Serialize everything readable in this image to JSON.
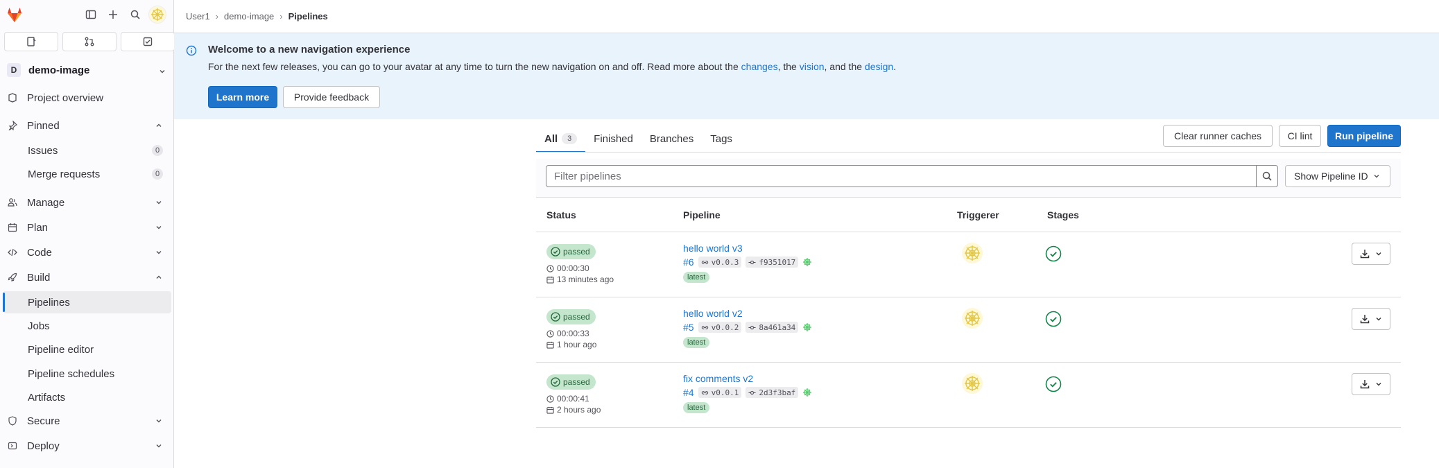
{
  "breadcrumb": {
    "items": [
      "User1",
      "demo-image"
    ],
    "current": "Pipelines"
  },
  "sidebar": {
    "project_initial": "D",
    "project_name": "demo-image",
    "overview": "Project overview",
    "pinned": "Pinned",
    "pinned_items": [
      {
        "label": "Issues",
        "count": "0"
      },
      {
        "label": "Merge requests",
        "count": "0"
      }
    ],
    "manage": "Manage",
    "plan": "Plan",
    "code": "Code",
    "build": "Build",
    "build_items": [
      "Pipelines",
      "Jobs",
      "Pipeline editor",
      "Pipeline schedules",
      "Artifacts"
    ],
    "secure": "Secure",
    "deploy": "Deploy"
  },
  "banner": {
    "title": "Welcome to a new navigation experience",
    "text_1": "For the next few releases, you can go to your avatar at any time to turn the new navigation on and off. Read more about the ",
    "link_1": "changes",
    "text_2": ", the ",
    "link_2": "vision",
    "text_3": ", and the ",
    "link_3": "design",
    "text_4": ".",
    "learn_more": "Learn more",
    "feedback": "Provide feedback"
  },
  "tabs": [
    {
      "label": "All",
      "count": "3"
    },
    {
      "label": "Finished"
    },
    {
      "label": "Branches"
    },
    {
      "label": "Tags"
    }
  ],
  "actions": {
    "clear_cache": "Clear runner caches",
    "ci_lint": "CI lint",
    "run": "Run pipeline"
  },
  "filter": {
    "placeholder": "Filter pipelines",
    "show_id": "Show Pipeline ID"
  },
  "table": {
    "headers": {
      "status": "Status",
      "pipeline": "Pipeline",
      "triggerer": "Triggerer",
      "stages": "Stages"
    },
    "rows": [
      {
        "status": "passed",
        "duration": "00:00:30",
        "finished": "13 minutes ago",
        "title": "hello world v3",
        "id": "#6",
        "tag": "v0.0.3",
        "commit": "f9351017",
        "ref_label": "latest"
      },
      {
        "status": "passed",
        "duration": "00:00:33",
        "finished": "1 hour ago",
        "title": "hello world v2",
        "id": "#5",
        "tag": "v0.0.2",
        "commit": "8a461a34",
        "ref_label": "latest"
      },
      {
        "status": "passed",
        "duration": "00:00:41",
        "finished": "2 hours ago",
        "title": "fix comments v2",
        "id": "#4",
        "tag": "v0.0.1",
        "commit": "2d3f3baf",
        "ref_label": "latest"
      }
    ]
  },
  "colors": {
    "accent": "#1f75cb",
    "success_bg": "#c3e6cd",
    "success_fg": "#24663b",
    "banner_bg": "#e9f3fc"
  }
}
